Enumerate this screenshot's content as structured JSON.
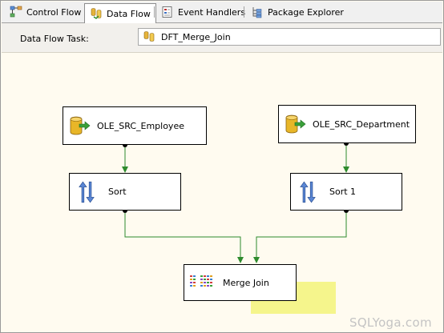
{
  "tabs": [
    {
      "label": "Control Flow",
      "icon": "control-flow-icon",
      "active": false
    },
    {
      "label": "Data Flow",
      "icon": "data-flow-icon",
      "active": true
    },
    {
      "label": "Event Handlers",
      "icon": "event-handlers-icon",
      "active": false
    },
    {
      "label": "Package Explorer",
      "icon": "package-explorer-icon",
      "active": false
    }
  ],
  "task": {
    "label": "Data Flow Task:",
    "selected": "DFT_Merge_Join"
  },
  "nodes": {
    "src_employee": "OLE_SRC_Employee",
    "src_department": "OLE_SRC_Department",
    "sort": "Sort",
    "sort1": "Sort 1",
    "merge_join": "Merge Join"
  },
  "watermark": "SQLYoga.com",
  "colors": {
    "canvas": "#fffbf0",
    "path": "#2e8b2e",
    "highlight": "#f3f37a"
  }
}
